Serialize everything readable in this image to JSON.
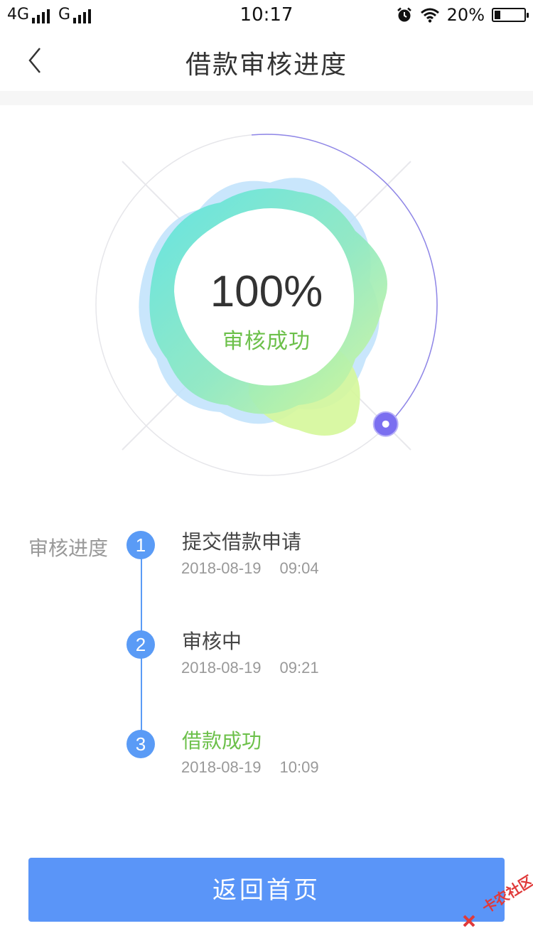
{
  "status_bar": {
    "network_1": "4G",
    "network_2": "G",
    "time": "10:17",
    "battery": "20%",
    "battery_level": 0.2,
    "icons": [
      "signal-icon",
      "alarm-icon",
      "wifi-icon",
      "battery-icon"
    ]
  },
  "header": {
    "title": "借款审核进度",
    "back_icon": "chevron-left-icon"
  },
  "gauge": {
    "percent": "100%",
    "status": "审核成功",
    "progress": 1.0,
    "colors": {
      "cyan": "#5ce3e0",
      "blue": "#bfe2fb",
      "lime": "#d5f79a",
      "green": "#6cc04a",
      "indicator": "#7b6ff0"
    }
  },
  "progress": {
    "label": "审核进度",
    "steps": [
      {
        "number": "1",
        "title": "提交借款申请",
        "date": "2018-08-19",
        "time": "09:04"
      },
      {
        "number": "2",
        "title": "审核中",
        "date": "2018-08-19",
        "time": "09:21"
      },
      {
        "number": "3",
        "title": "借款成功",
        "date": "2018-08-19",
        "time": "10:09"
      }
    ]
  },
  "footer": {
    "home_button": "返回首页",
    "accent": "#5a95f8"
  },
  "watermark": {
    "text": "卡农社区"
  }
}
